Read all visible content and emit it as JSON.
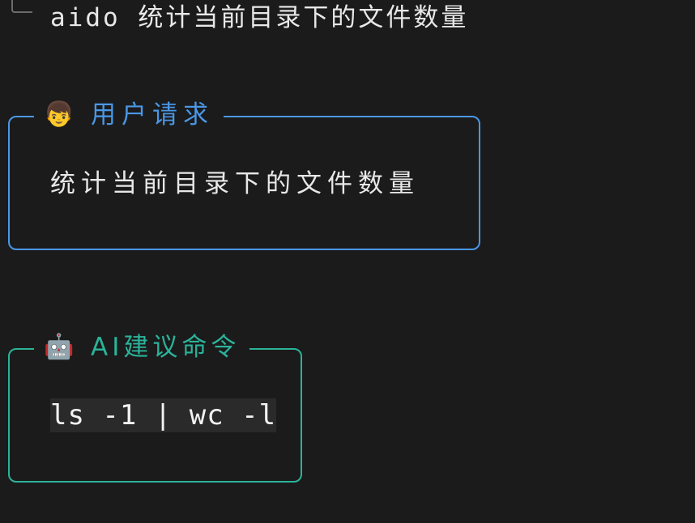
{
  "prompt": {
    "text": "aido 统计当前目录下的文件数量"
  },
  "user_panel": {
    "icon": "boy-face-emoji",
    "icon_glyph": "👦",
    "title": "用户请求",
    "body": "统计当前目录下的文件数量",
    "accent_color": "#4a97e6"
  },
  "ai_panel": {
    "icon": "robot-face-emoji",
    "icon_glyph": "🤖",
    "title": "AI建议命令",
    "command": "ls -1 | wc -l",
    "accent_color": "#2bb39a"
  }
}
